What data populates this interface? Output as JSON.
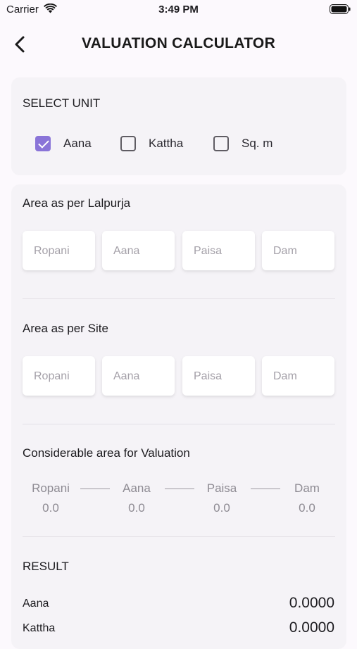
{
  "status_bar": {
    "carrier": "Carrier",
    "time": "3:49 PM"
  },
  "header": {
    "title": "VALUATION CALCULATOR"
  },
  "unit_section": {
    "title": "SELECT UNIT",
    "options": [
      {
        "label": "Aana",
        "checked": true
      },
      {
        "label": "Kattha",
        "checked": false
      },
      {
        "label": "Sq. m",
        "checked": false
      }
    ]
  },
  "lalpurja": {
    "title": "Area as per Lalpurja",
    "fields": [
      {
        "placeholder": "Ropani",
        "value": ""
      },
      {
        "placeholder": "Aana",
        "value": ""
      },
      {
        "placeholder": "Paisa",
        "value": ""
      },
      {
        "placeholder": "Dam",
        "value": ""
      }
    ]
  },
  "site": {
    "title": "Area as per Site",
    "fields": [
      {
        "placeholder": "Ropani",
        "value": ""
      },
      {
        "placeholder": "Aana",
        "value": ""
      },
      {
        "placeholder": "Paisa",
        "value": ""
      },
      {
        "placeholder": "Dam",
        "value": ""
      }
    ]
  },
  "considerable": {
    "title": "Considerable area for Valuation",
    "items": [
      {
        "label": "Ropani",
        "value": "0.0"
      },
      {
        "label": "Aana",
        "value": "0.0"
      },
      {
        "label": "Paisa",
        "value": "0.0"
      },
      {
        "label": "Dam",
        "value": "0.0"
      }
    ]
  },
  "result": {
    "title": "RESULT",
    "rows": [
      {
        "label": "Aana",
        "value": "0.0000"
      },
      {
        "label": "Kattha",
        "value": "0.0000"
      }
    ]
  },
  "colors": {
    "accent": "#8a74d8",
    "background": "#fcf9fd",
    "card": "#f5f3f7"
  }
}
